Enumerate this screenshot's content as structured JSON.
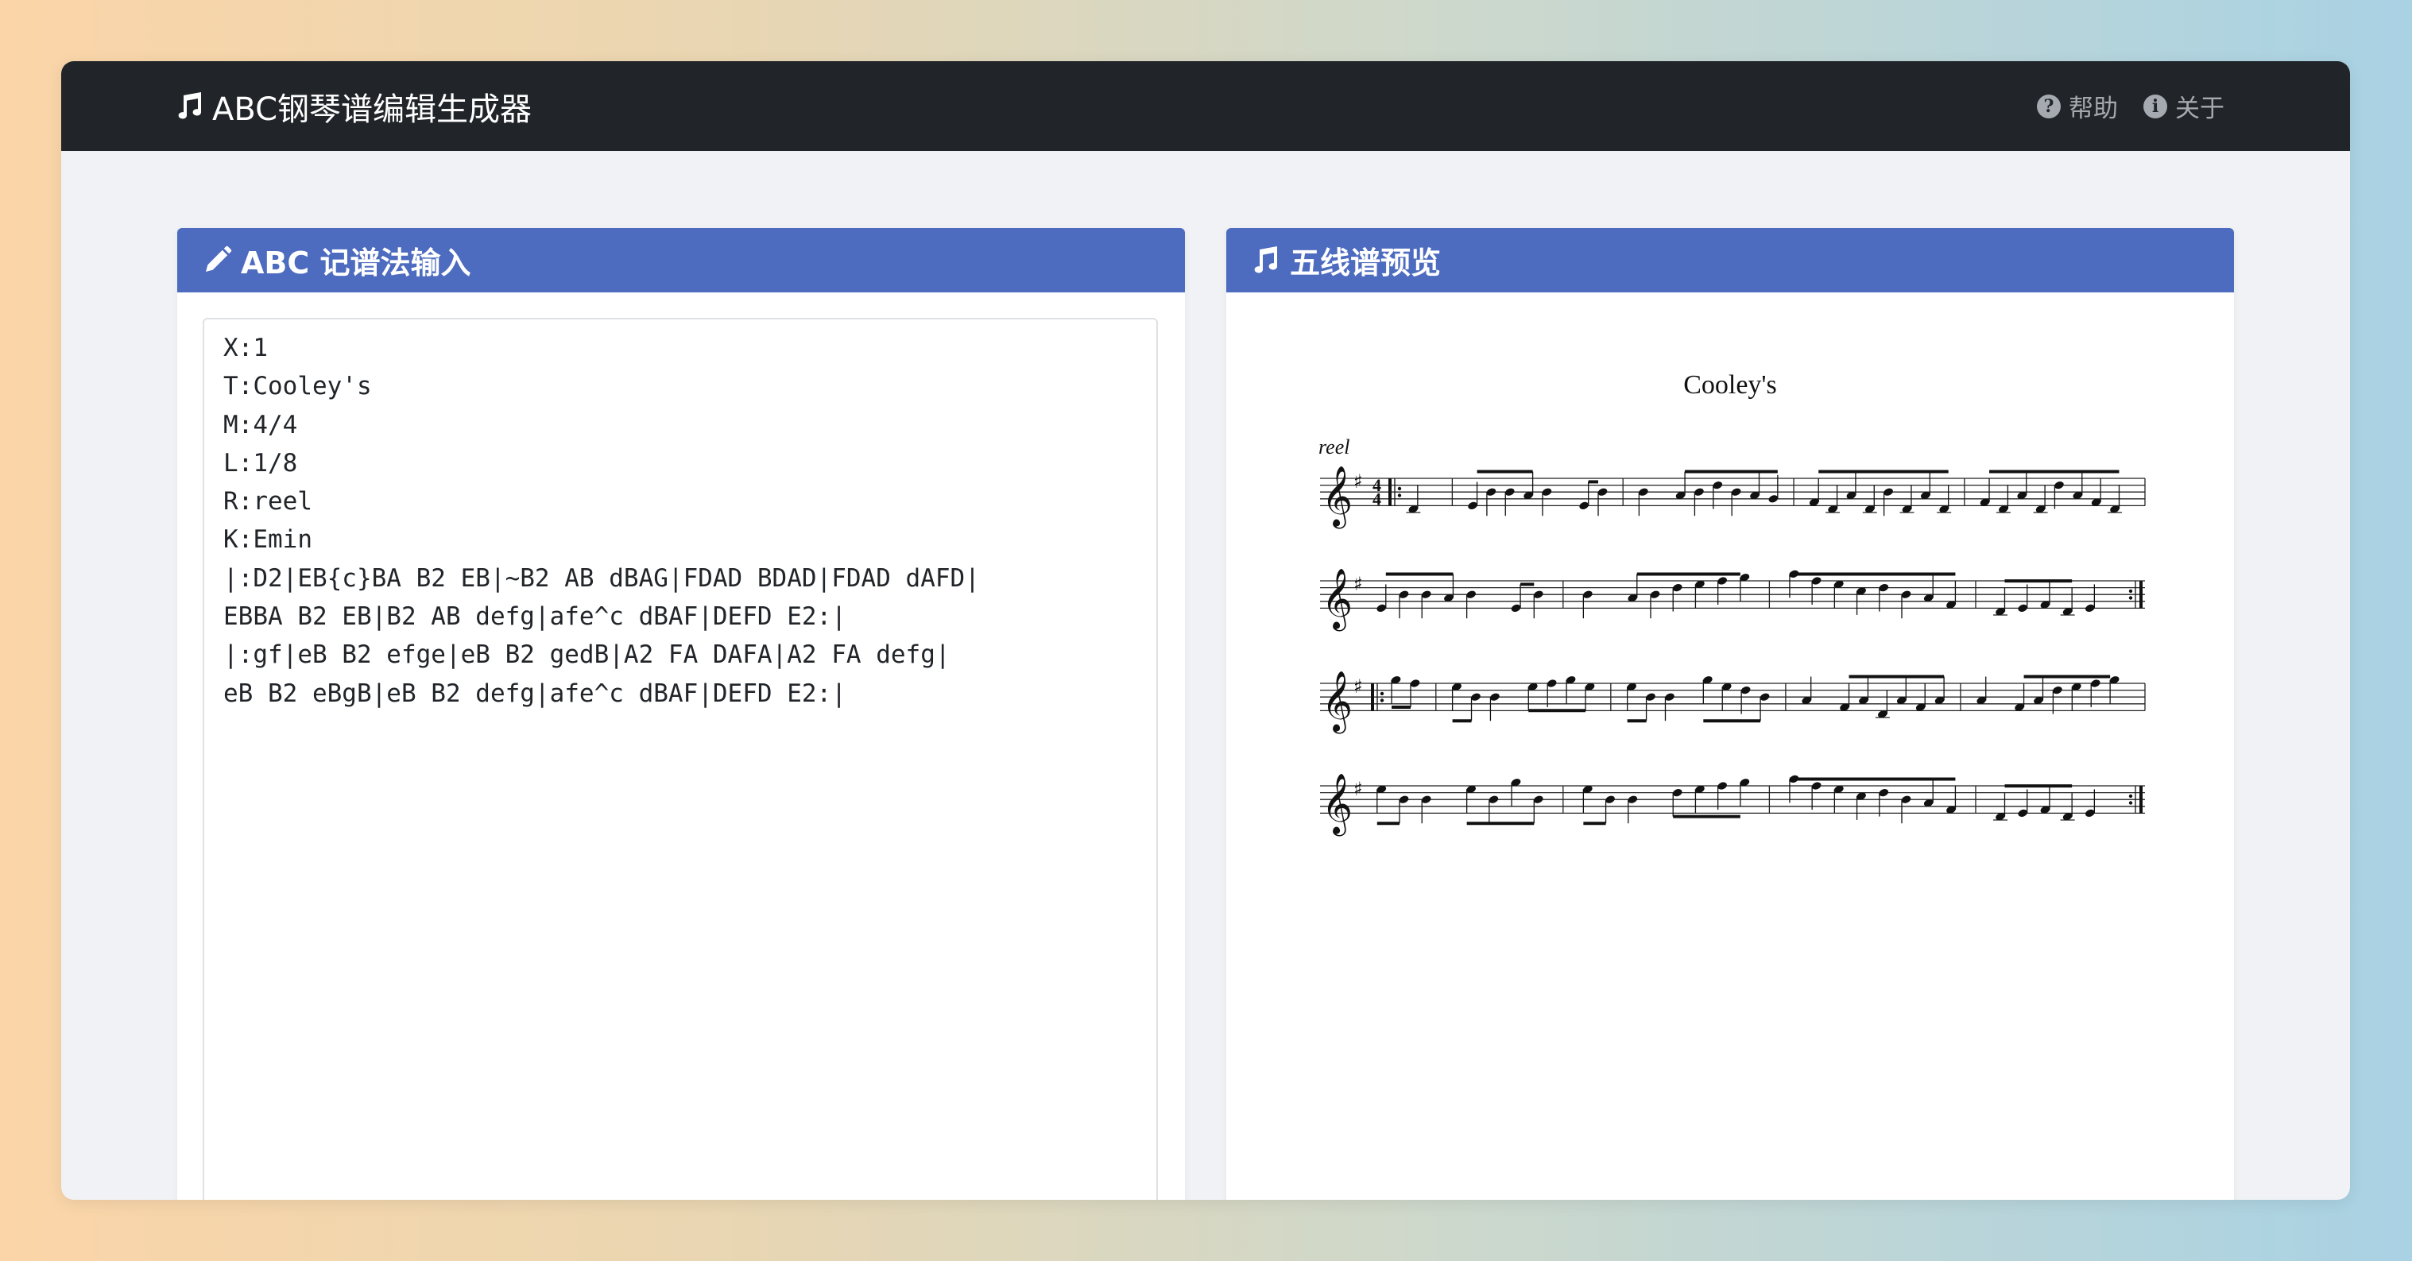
{
  "app": {
    "title": "ABC钢琴谱编辑生成器"
  },
  "nav": {
    "help": "帮助",
    "about": "关于"
  },
  "icons": {
    "brand": "music-note-icon",
    "help": "question-circle-icon",
    "about": "info-circle-icon",
    "editor_header": "pencil-icon",
    "preview_header": "music-note-icon"
  },
  "colors": {
    "navbar": "#212529",
    "panel_header": "#4d6bbf",
    "background": "#f0f2f6"
  },
  "editor": {
    "header": "ABC 记谱法输入",
    "content": "X:1\nT:Cooley's\nM:4/4\nL:1/8\nR:reel\nK:Emin\n|:D2|EB{c}BA B2 EB|~B2 AB dBAG|FDAD BDAD|FDAD dAFD|\nEBBA B2 EB|B2 AB defg|afe^c dBAF|DEFD E2:|\n|:gf|eB B2 efge|eB B2 gedB|A2 FA DAFA|A2 FA defg|\neB B2 eBgB|eB B2 defg|afe^c dBAF|DEFD E2:|"
  },
  "preview": {
    "header": "五线谱预览",
    "title": "Cooley's",
    "tempo": "reel",
    "meter_top": "4",
    "meter_bottom": "4"
  }
}
